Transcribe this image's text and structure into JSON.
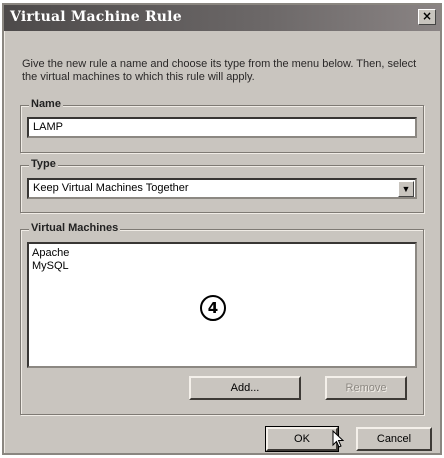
{
  "window": {
    "title": "Virtual Machine Rule",
    "close_label": "×"
  },
  "instructions": "Give the new rule a name and choose its type from the menu below. Then, select the virtual machines to which this rule will apply.",
  "name_group": {
    "label": "Name",
    "value": "LAMP"
  },
  "type_group": {
    "label": "Type",
    "value": "Keep Virtual Machines Together",
    "arrow": "▼"
  },
  "vm_group": {
    "label": "Virtual Machines",
    "items": [
      "Apache",
      "MySQL"
    ]
  },
  "callout": "4",
  "buttons": {
    "add": "Add...",
    "remove": "Remove",
    "ok": "OK",
    "cancel": "Cancel"
  },
  "icons": {
    "cursor": "arrow-cursor-icon",
    "dropdown": "chevron-down-icon",
    "close": "close-icon"
  }
}
